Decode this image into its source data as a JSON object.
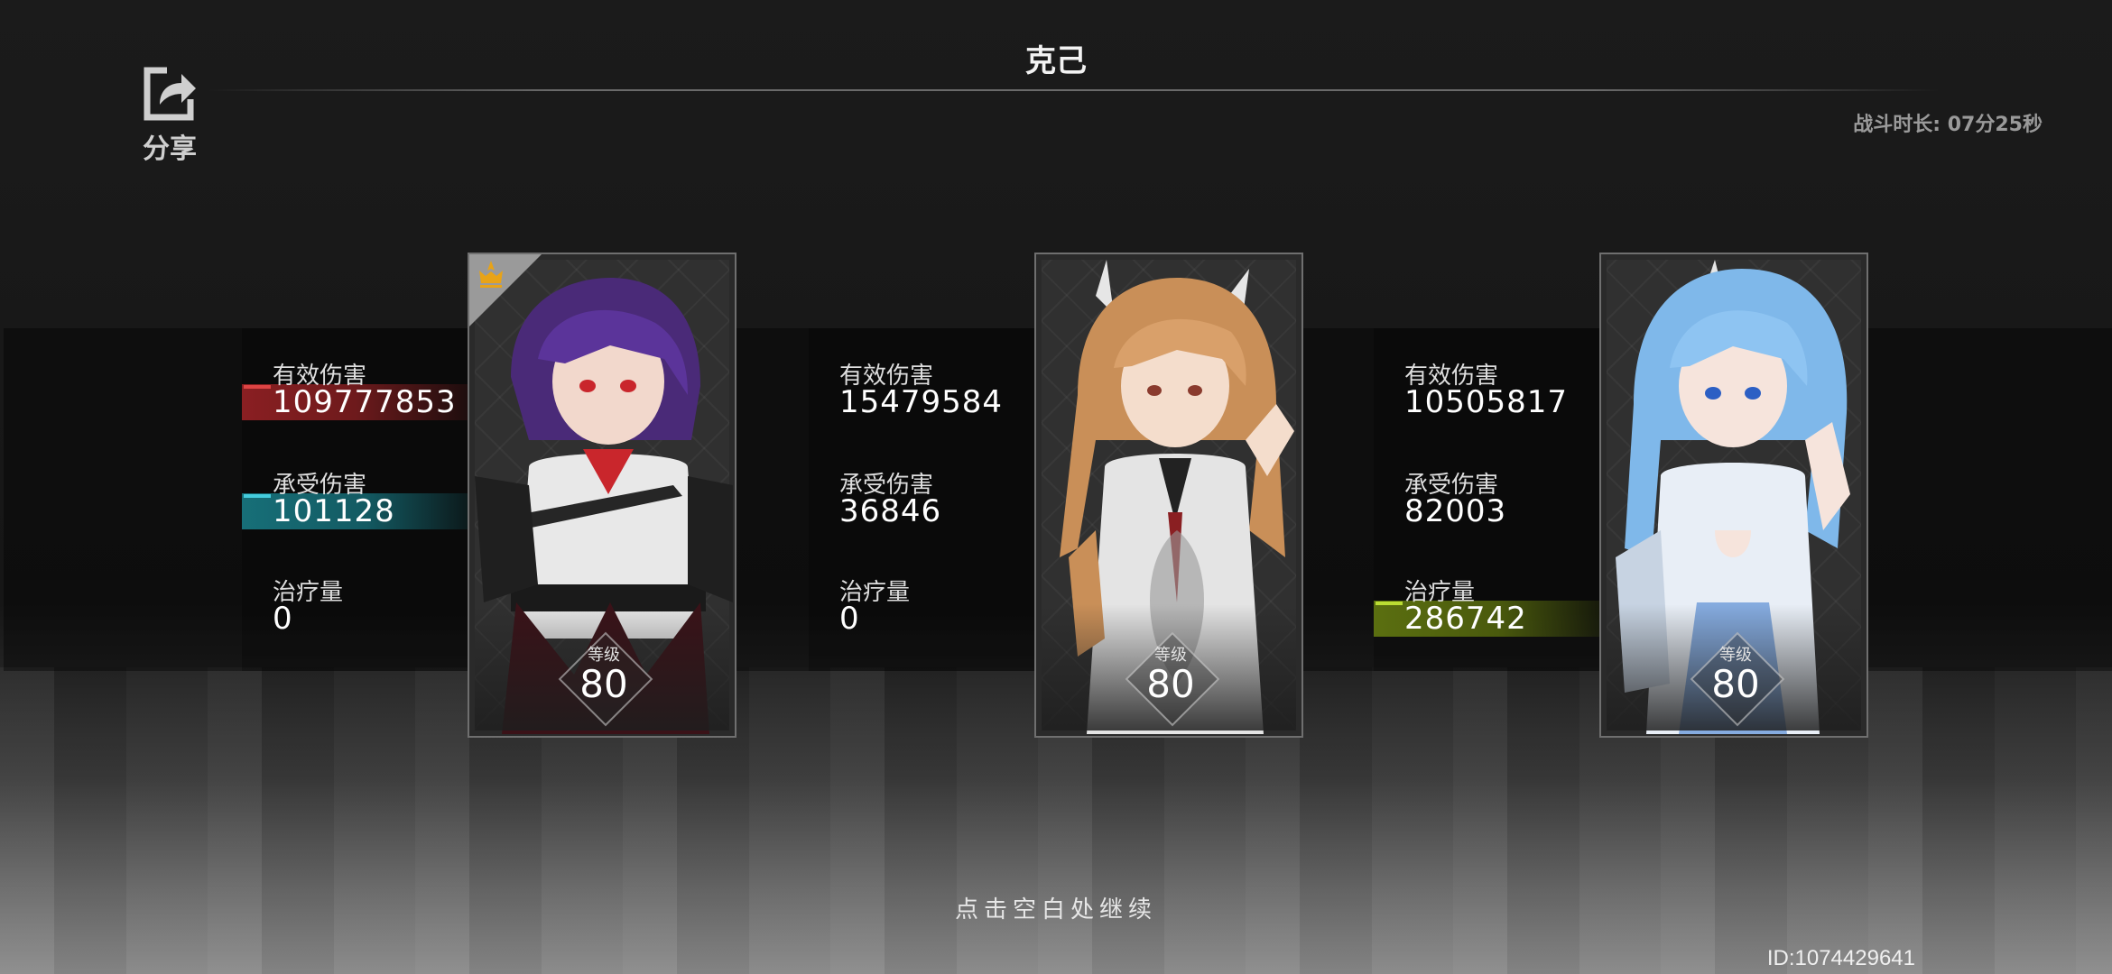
{
  "header": {
    "title": "克己",
    "share_label": "分享",
    "duration": "战斗时长: 07分25秒"
  },
  "characters": [
    {
      "stats": {
        "damage_label": "有效伤害",
        "damage": "109777853",
        "taken_label": "承受伤害",
        "taken": "101128",
        "heal_label": "治疗量",
        "heal": "0"
      },
      "level_label": "等级",
      "level": "80",
      "mvp": true,
      "highlights": [
        "damage-red",
        "taken-cyan"
      ]
    },
    {
      "stats": {
        "damage_label": "有效伤害",
        "damage": "15479584",
        "taken_label": "承受伤害",
        "taken": "36846",
        "heal_label": "治疗量",
        "heal": "0"
      },
      "level_label": "等级",
      "level": "80",
      "mvp": false,
      "highlights": []
    },
    {
      "stats": {
        "damage_label": "有效伤害",
        "damage": "10505817",
        "taken_label": "承受伤害",
        "taken": "82003",
        "heal_label": "治疗量",
        "heal": "286742"
      },
      "level_label": "等级",
      "level": "80",
      "mvp": false,
      "highlights": [
        "heal-green"
      ]
    }
  ],
  "footer": {
    "continue_hint": "点击空白处继续",
    "user_id": "ID:1074429641"
  },
  "colors": {
    "damage_highlight": "#8a1f22",
    "taken_highlight": "#176f78",
    "heal_highlight": "#5b6f10",
    "mvp_icon": "#e8a317"
  },
  "icons": [
    "share-icon",
    "mvp-crown-icon",
    "level-diamond-icon"
  ]
}
